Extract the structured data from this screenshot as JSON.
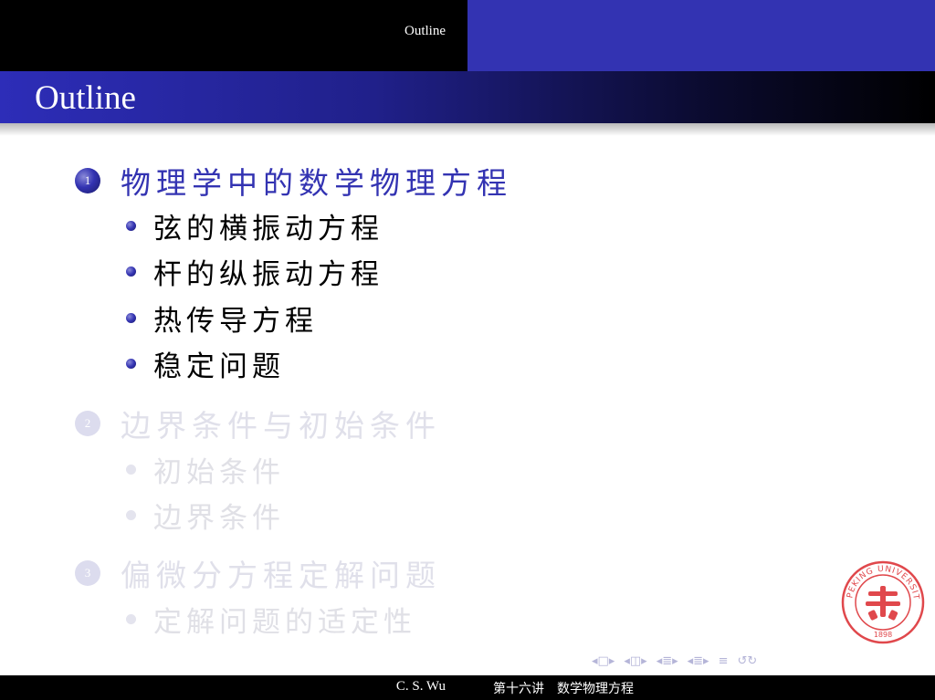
{
  "header": {
    "nav_label": "Outline"
  },
  "frame": {
    "title": "Outline"
  },
  "toc": {
    "sections": [
      {
        "number": "1",
        "title": "物理学中的数学物理方程",
        "state": "active",
        "subsections": [
          "弦的横振动方程",
          "杆的纵振动方程",
          "热传导方程",
          "稳定问题"
        ]
      },
      {
        "number": "2",
        "title": "边界条件与初始条件",
        "state": "faded",
        "subsections": [
          "初始条件",
          "边界条件"
        ]
      },
      {
        "number": "3",
        "title": "偏微分方程定解问题",
        "state": "faded",
        "subsections": [
          "定解问题的适定性"
        ]
      }
    ]
  },
  "seal": {
    "text": "PEKING UNIVERSITY",
    "year": "1898",
    "color": "#e0484c",
    "icon": "peking-university-seal-icon"
  },
  "footer": {
    "author": "C. S. Wu",
    "lecture": "第十六讲　数学物理方程"
  },
  "colors": {
    "accent": "#3333b2",
    "header_left": "#000000",
    "header_right": "#3333b2"
  }
}
